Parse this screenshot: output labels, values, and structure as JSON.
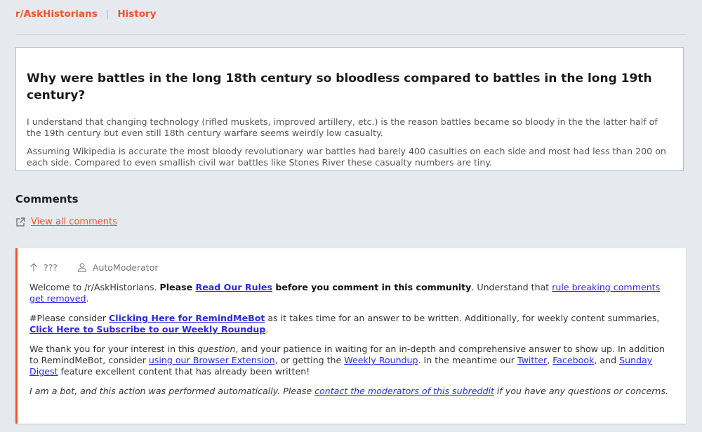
{
  "nav": {
    "subreddit": "r/AskHistorians",
    "separator": "|",
    "flair": "History"
  },
  "post": {
    "title": "Why were battles in the long 18th century so bloodless compared to battles in the long 19th century?",
    "paragraphs": [
      "I understand that changing technology (rifled muskets, improved artillery, etc.) is the reason battles became so bloody in the the latter half of the 19th century but even still 18th century warfare seems weirdly low casualty.",
      "Assuming Wikipedia is accurate the most bloody revolutionary war battles had barely 400 casulties on each side and most had less than 200 on each side. Compared to even smallish civil war battles like Stones River these casualty numbers are tiny."
    ]
  },
  "comments_section": {
    "heading": "Comments",
    "view_all": "View all comments"
  },
  "comment": {
    "score": "???",
    "author": "AutoModerator",
    "p1": {
      "t1": "Welcome to /r/AskHistorians. ",
      "b1": "Please ",
      "link1": "Read Our Rules",
      "b2": " before you comment in this community",
      "t2": ". Understand that ",
      "link2": "rule breaking comments get removed",
      "t3": "."
    },
    "p2": {
      "t1": "#Please consider ",
      "link1": "Clicking Here for RemindMeBot",
      "t2": " as it takes time for an answer to be written. Additionally, for weekly content summaries, ",
      "link2": "Click Here to Subscribe to our Weekly Roundup",
      "t3": "."
    },
    "p3": {
      "t1": "We thank you for your interest in this ",
      "i1": "question",
      "t2": ", and your patience in waiting for an in-depth and comprehensive answer to show up. In addition to RemindMeBot, consider ",
      "link1": "using our Browser Extension",
      "t3": ", or getting the ",
      "link2": "Weekly Roundup",
      "t4": ". In the meantime our ",
      "link3": "Twitter",
      "t5": ", ",
      "link4": "Facebook",
      "t6": ", and ",
      "link5": "Sunday Digest",
      "t7": " feature excellent content that has already been written!"
    },
    "p4": {
      "t1": "I am a bot, and this action was performed automatically. Please ",
      "link1": "contact the moderators of this subreddit",
      "t2": " if you have any questions or concerns."
    }
  },
  "colors": {
    "accent": "#f0552a",
    "link": "#2a2ae0",
    "background": "#e6e9ee"
  }
}
